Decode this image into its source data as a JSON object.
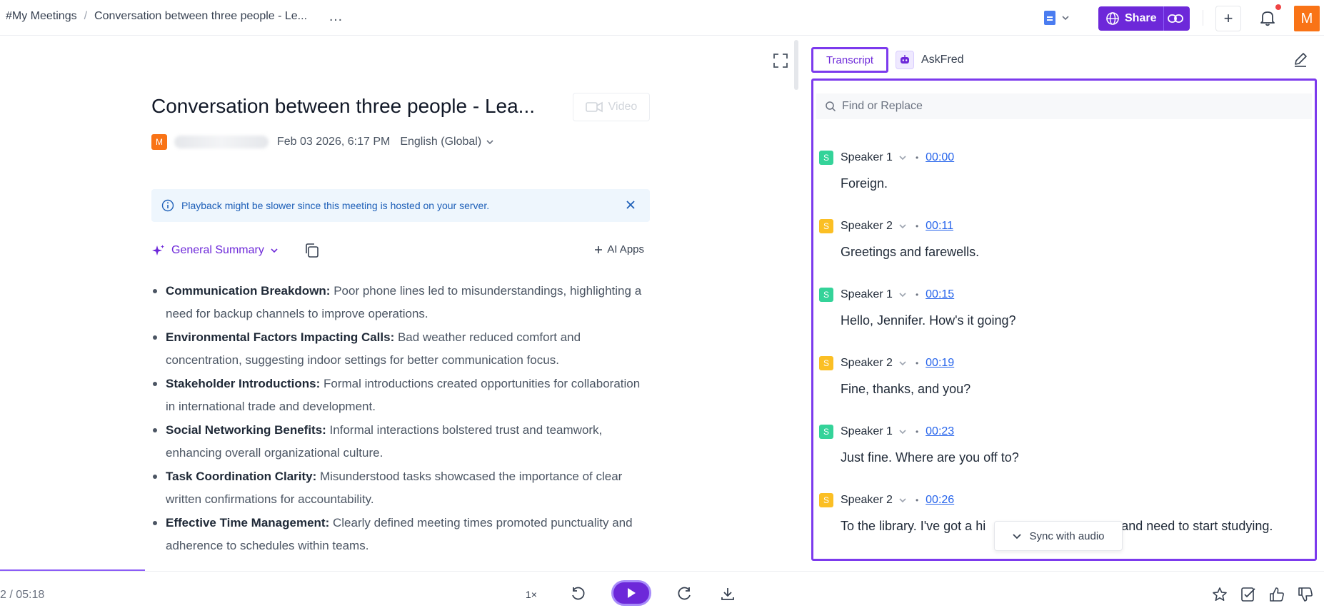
{
  "breadcrumb": {
    "root": "#My Meetings",
    "separator": "/",
    "current": "Conversation between three people - Le...",
    "more": "…"
  },
  "header": {
    "share_label": "Share",
    "plus_label": "+",
    "avatar_letter": "M"
  },
  "meeting": {
    "title": "Conversation between three people - Lea...",
    "video_label": "Video",
    "avatar_letter": "M",
    "date": "Feb 03 2026, 6:17 PM",
    "language": "English (Global)"
  },
  "banner": {
    "text": "Playback might be slower since this meeting is hosted on your server."
  },
  "summary": {
    "label": "General Summary",
    "ai_apps_label": "AI Apps",
    "bullets": [
      {
        "title": "Communication Breakdown:",
        "text": " Poor phone lines led to misunderstandings, highlighting a need for backup channels to improve operations."
      },
      {
        "title": "Environmental Factors Impacting Calls:",
        "text": " Bad weather reduced comfort and concentration, suggesting indoor settings for better communication focus."
      },
      {
        "title": "Stakeholder Introductions:",
        "text": " Formal introductions created opportunities for collaboration in international trade and development."
      },
      {
        "title": "Social Networking Benefits:",
        "text": " Informal interactions bolstered trust and teamwork, enhancing overall organizational culture."
      },
      {
        "title": "Task Coordination Clarity:",
        "text": " Misunderstood tasks showcased the importance of clear written confirmations for accountability."
      },
      {
        "title": "Effective Time Management:",
        "text": " Clearly defined meeting times promoted punctuality and adherence to schedules within teams."
      }
    ]
  },
  "tabs": {
    "transcript": "Transcript",
    "askfred": "AskFred"
  },
  "transcript": {
    "search_placeholder": "Find or Replace",
    "entries": [
      {
        "avatar": "S",
        "speaker": "Speaker 1",
        "time": "00:00",
        "text": "Foreign.",
        "color": "#34d399"
      },
      {
        "avatar": "S",
        "speaker": "Speaker 2",
        "time": "00:11",
        "text": "Greetings and farewells.",
        "color": "#fbbf24"
      },
      {
        "avatar": "S",
        "speaker": "Speaker 1",
        "time": "00:15",
        "text": "Hello, Jennifer. How's it going?",
        "color": "#34d399"
      },
      {
        "avatar": "S",
        "speaker": "Speaker 2",
        "time": "00:19",
        "text": "Fine, thanks, and you?",
        "color": "#fbbf24"
      },
      {
        "avatar": "S",
        "speaker": "Speaker 1",
        "time": "00:23",
        "text": "Just fine. Where are you off to?",
        "color": "#34d399"
      },
      {
        "avatar": "S",
        "speaker": "Speaker 2",
        "time": "00:26",
        "text": "To the library. I've got a hi",
        "text_after": "and need to start studying.",
        "color": "#fbbf24"
      }
    ],
    "sync_label": "Sync with audio"
  },
  "player": {
    "time": "2 / 05:18",
    "speed": "1×",
    "progress_fraction": 0.011
  },
  "colors": {
    "accent": "#6d28d9",
    "avatar_orange": "#f97316",
    "banner_bg": "#eef6fd",
    "link_blue": "#2563eb"
  }
}
